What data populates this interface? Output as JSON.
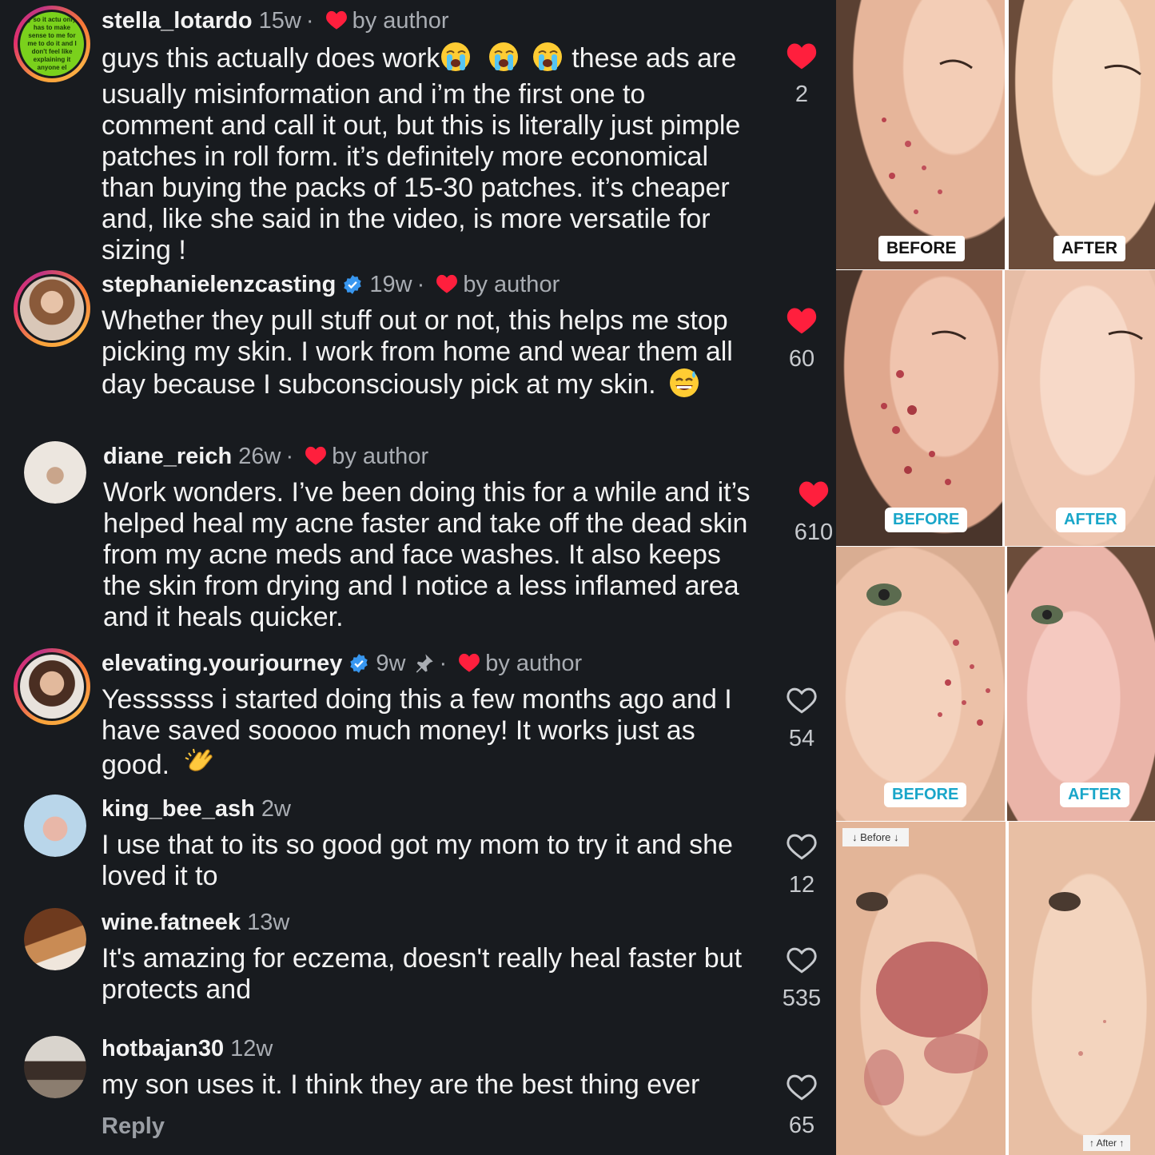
{
  "comments": [
    {
      "username": "stella_lotardo",
      "time": "15w",
      "by_author": "by author",
      "text": "guys this actually does work",
      "text2": "these ads are usually misinformation and i’m the first one to comment and call it out, but this is literally just pimple patches in roll form. it’s definitely more economical than buying the packs of 15-30 patches. it’s cheaper and, like she said in the video, is more versatile for sizing !",
      "likes": "2",
      "liked": true,
      "avatar_text": "y so it actu only has to make sense to me for me to do it and I don't feel like explaining it anyone el"
    },
    {
      "username": "stephanielenzcasting",
      "time": "19w",
      "by_author": "by author",
      "text": "Whether they pull stuff out or not, this helps me stop picking my skin. I work from home and wear them all day because I subconsciously pick at my skin.",
      "likes": "60",
      "liked": true
    },
    {
      "username": "diane_reich",
      "time": "26w",
      "by_author": "by author",
      "text": "Work wonders. I’ve been doing this for a while and it’s helped heal my acne faster and take off the dead skin from my acne meds and face washes. It also keeps the skin from drying and I notice a less inflamed area and it heals quicker.",
      "likes": "610",
      "liked": true
    },
    {
      "username": "elevating.yourjourney",
      "time": "9w",
      "by_author": "by author",
      "text": "Yessssss i started doing this a few months ago and I have saved sooooo much money!  It works just as good.",
      "likes": "54",
      "liked": false
    },
    {
      "username": "king_bee_ash",
      "time": "2w",
      "text": "I use that to its so good got my mom to try it and she loved it to",
      "likes": "12",
      "liked": false
    },
    {
      "username": "wine.fatneek",
      "time": "13w",
      "text": "It's amazing for eczema, doesn't really heal faster but protects and",
      "likes": "535",
      "liked": false
    },
    {
      "username": "hotbajan30",
      "time": "12w",
      "text": "my son uses it. I think they are the best thing ever",
      "likes": "65",
      "liked": false
    }
  ],
  "reply_label": "Reply",
  "gallery": {
    "labels": {
      "before1": "BEFORE",
      "after1": "AFTER",
      "before2": "BEFORE",
      "after2": "AFTER",
      "before3": "BEFORE",
      "after3": "AFTER",
      "before4": "↓ Before ↓",
      "after4": "↑ After ↑"
    }
  },
  "colors": {
    "background": "#181b1f",
    "heart_red": "#ff1f3d",
    "verified_blue": "#3897f0",
    "teal_label": "#19a6c9"
  }
}
